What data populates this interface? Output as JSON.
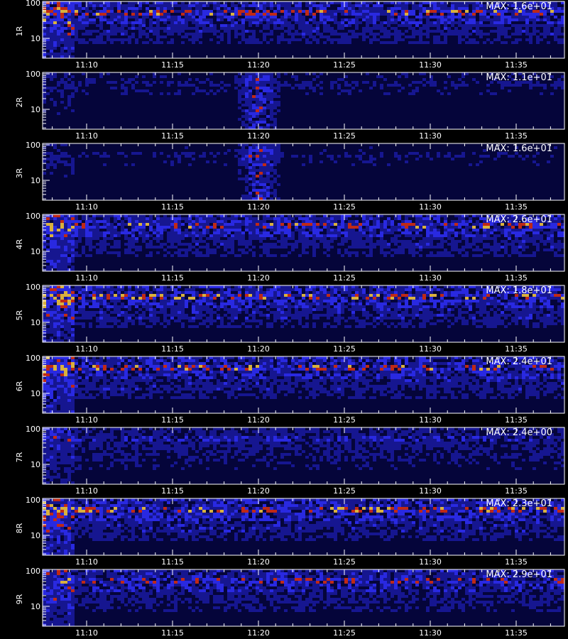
{
  "chart_data": {
    "type": "heatmap",
    "panels": [
      {
        "name": "1R",
        "max_label": "MAX: 1.6e+01",
        "intensity": 0.9
      },
      {
        "name": "2R",
        "max_label": "MAX: 1.1e+01",
        "intensity": 0.25,
        "burst": true
      },
      {
        "name": "3R",
        "max_label": "MAX: 1.6e+01",
        "intensity": 0.22,
        "burst": true
      },
      {
        "name": "4R",
        "max_label": "MAX: 2.6e+01",
        "intensity": 0.9
      },
      {
        "name": "5R",
        "max_label": "MAX: 1.8e+01",
        "intensity": 0.95
      },
      {
        "name": "6R",
        "max_label": "MAX: 2.4e+01",
        "intensity": 0.9
      },
      {
        "name": "7R",
        "max_label": "MAX: 2.4e+00",
        "intensity": 0.55
      },
      {
        "name": "8R",
        "max_label": "MAX: 2.3e+01",
        "intensity": 0.95
      },
      {
        "name": "9R",
        "max_label": "MAX: 2.9e+01",
        "intensity": 0.8
      }
    ],
    "x_ticks": [
      "11:10",
      "11:15",
      "11:20",
      "11:25",
      "11:30",
      "11:35"
    ],
    "y_ticks": [
      "100",
      "10"
    ],
    "y_scale": "log",
    "colors": {
      "background": "#000000",
      "low": "#1a1aa0",
      "mid": "#3030ff",
      "high": "#e03010",
      "peak": "#ffd040",
      "axes": "#ffffff"
    }
  }
}
